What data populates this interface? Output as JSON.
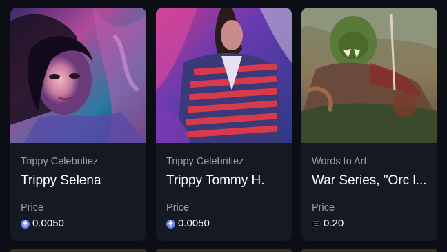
{
  "cards": [
    {
      "collection": "Trippy Celebritiez",
      "title": "Trippy Selena",
      "price_label": "Price",
      "price": "0.0050",
      "currency_icon": "ethereum-icon",
      "colors": {
        "coin": "#6b7fe6"
      }
    },
    {
      "collection": "Trippy Celebritiez",
      "title": "Trippy Tommy H.",
      "price_label": "Price",
      "price": "0.0050",
      "currency_icon": "ethereum-icon",
      "colors": {
        "coin": "#6b7fe6"
      }
    },
    {
      "collection": "Words to Art",
      "title": "War Series, \"Orc l...",
      "price_label": "Price",
      "price": "0.20",
      "currency_icon": "solana-icon",
      "colors": {
        "coin": "#000000"
      }
    }
  ],
  "theme": {
    "background": "#0b0e14",
    "card": "#141923",
    "muted_text": "#9aa0aa",
    "text": "#ffffff"
  }
}
